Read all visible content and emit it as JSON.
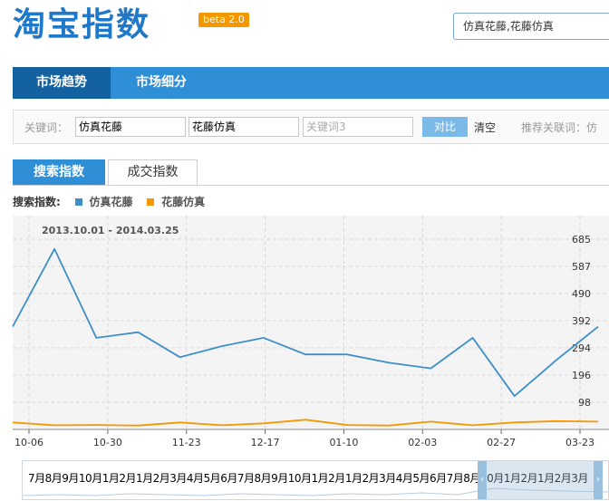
{
  "header": {
    "logo_text": "淘宝指数",
    "beta_badge": "beta 2.0",
    "search_value": "仿真花藤,花藤仿真"
  },
  "nav": {
    "tabs": [
      {
        "label": "市场趋势"
      },
      {
        "label": "市场细分"
      }
    ]
  },
  "keywords": {
    "label": "关键词：",
    "kw1": "仿真花藤",
    "kw2": "花藤仿真",
    "kw3_placeholder": "关键词3",
    "compare_label": "对比",
    "clear_label": "清空",
    "recommend_label": "推荐关联词：仿"
  },
  "chart_tabs": [
    {
      "label": "搜索指数"
    },
    {
      "label": "成交指数"
    }
  ],
  "legend": {
    "title": "搜索指数:",
    "series": [
      {
        "name": "仿真花藤",
        "color": "#3d8fc7"
      },
      {
        "name": "花藤仿真",
        "color": "#f39800"
      }
    ]
  },
  "timeline": {
    "labels": [
      "7月",
      "8月",
      "9月",
      "10月",
      "1月",
      "2月",
      "1月",
      "2月",
      "3月",
      "4月",
      "5月",
      "6月",
      "7月",
      "8月",
      "9月",
      "10月",
      "1月",
      "2月",
      "1月",
      "2月",
      "3月",
      "4月",
      "5月",
      "6月",
      "7月",
      "8月",
      "",
      "10月",
      "1月",
      "2月",
      "1月",
      "2月",
      "3月"
    ]
  },
  "chart_data": {
    "type": "line",
    "date_range": "2013.10.01 - 2014.03.25",
    "x_tick_labels": [
      "10-06",
      "10-30",
      "11-23",
      "12-17",
      "01-10",
      "02-03",
      "02-27",
      "03-23"
    ],
    "y_ticks": [
      98,
      196,
      294,
      392,
      490,
      587,
      685
    ],
    "ylim": [
      0,
      770
    ],
    "grid": true,
    "series": [
      {
        "name": "仿真花藤",
        "color": "#3d8fc7",
        "values": [
          370,
          650,
          330,
          350,
          260,
          300,
          330,
          270,
          270,
          240,
          220,
          330,
          120,
          250,
          370
        ]
      },
      {
        "name": "花藤仿真",
        "color": "#f39800",
        "values": [
          25,
          15,
          16,
          14,
          25,
          15,
          22,
          35,
          16,
          14,
          28,
          15,
          25,
          30,
          28
        ]
      }
    ]
  }
}
